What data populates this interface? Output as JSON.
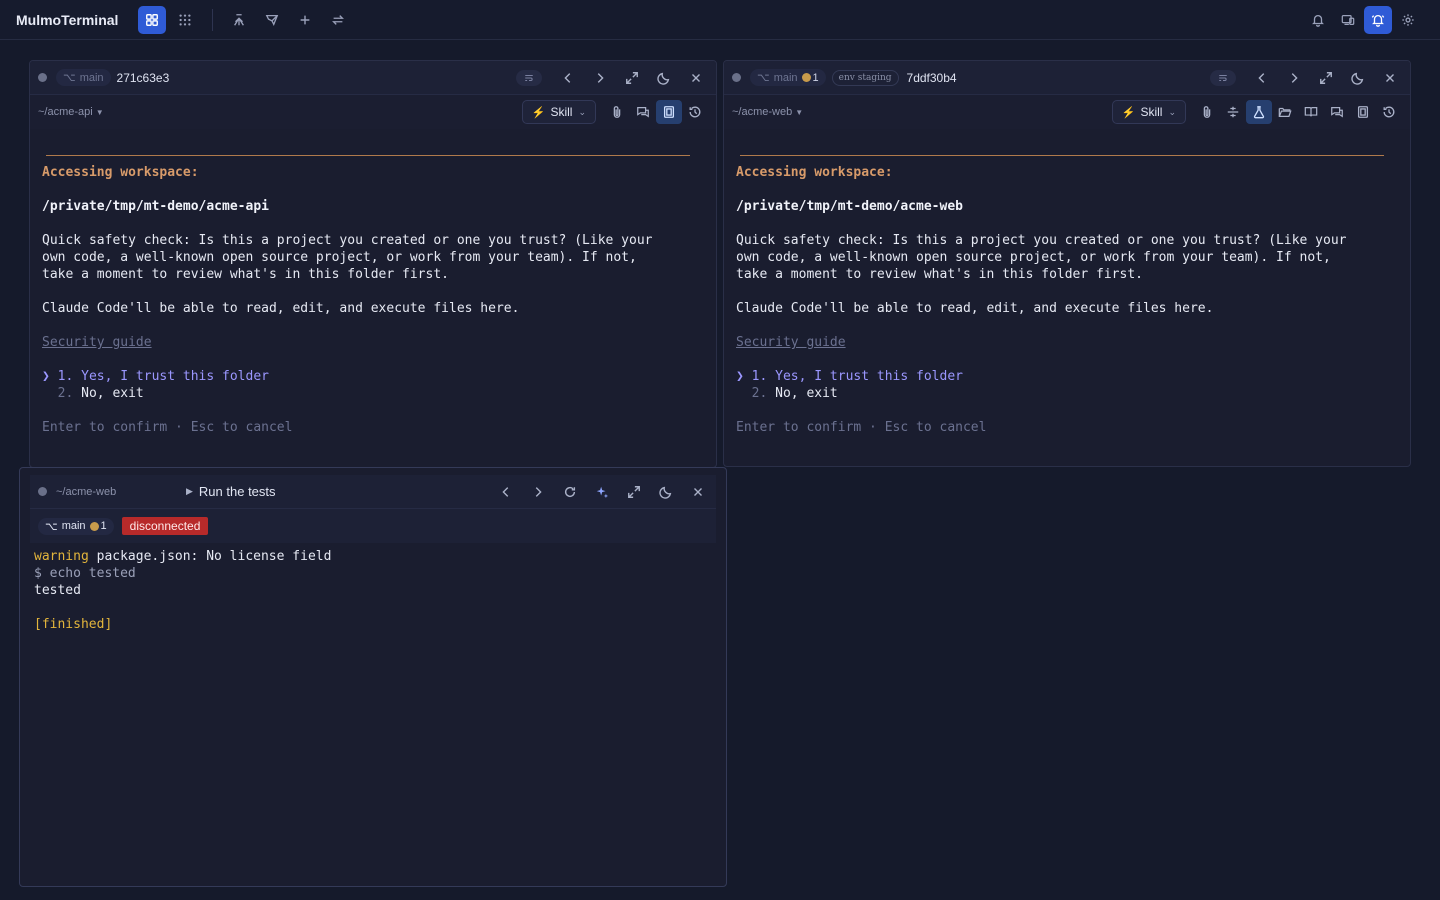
{
  "app": {
    "title": "MulmoTerminal"
  },
  "toolbar": {
    "left_icons": [
      "layout-grid-icon",
      "apps-icon",
      "merge-icon",
      "send-icon",
      "plus-icon",
      "swap-icon"
    ],
    "right_icons": [
      "bell-icon",
      "devices-icon",
      "notification-alert-icon",
      "gear-icon"
    ]
  },
  "panels": [
    {
      "branch": "main",
      "hash": "271c63e3",
      "path": "~/acme-api",
      "skill_label": "Skill",
      "terminal": {
        "heading": "Accessing workspace:",
        "workspace": "/private/tmp/mt-demo/acme-api",
        "safety_1": "Quick safety check: Is this a project you created or one you trust? (Like your",
        "safety_2": "own code, a well-known open source project, or work from your team). If not,",
        "safety_3": "take a moment to review what's in this folder first.",
        "ability": "Claude Code'll be able to read, edit, and execute files here.",
        "guide": "Security guide",
        "option1": "❯ 1. Yes, I trust this folder",
        "option2_num": "  2.",
        "option2_text": " No, exit",
        "hint": "Enter to confirm · Esc to cancel"
      }
    },
    {
      "branch": "main",
      "branch_count": "1",
      "env": "env staging",
      "hash": "7ddf30b4",
      "path": "~/acme-web",
      "skill_label": "Skill",
      "terminal": {
        "heading": "Accessing workspace:",
        "workspace": "/private/tmp/mt-demo/acme-web",
        "safety_1": "Quick safety check: Is this a project you created or one you trust? (Like your",
        "safety_2": "own code, a well-known open source project, or work from your team). If not,",
        "safety_3": "take a moment to review what's in this folder first.",
        "ability": "Claude Code'll be able to read, edit, and execute files here.",
        "guide": "Security guide",
        "option1": "❯ 1. Yes, I trust this folder",
        "option2_num": "  2.",
        "option2_text": " No, exit",
        "hint": "Enter to confirm · Esc to cancel"
      }
    }
  ],
  "runner": {
    "path": "~/acme-web",
    "title": "Run the tests",
    "branch": "main",
    "branch_count": "1",
    "status": "disconnected",
    "output": {
      "warn_word": "warning",
      "warn_text": " package.json: No license field",
      "cmd": "$ echo tested",
      "result": "tested",
      "finished": "[finished]"
    }
  },
  "colors": {
    "background": "#151a2b",
    "accent": "#2f5bd6",
    "workspace_heading": "#d89b6a",
    "selected_option": "#9b97ff",
    "disconnected": "#b72a2a",
    "warning": "#e3b53c"
  }
}
